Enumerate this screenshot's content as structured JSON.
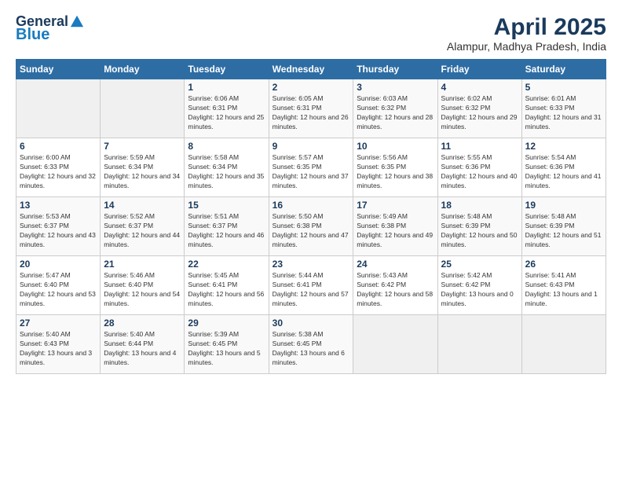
{
  "header": {
    "logo_general": "General",
    "logo_blue": "Blue",
    "month_title": "April 2025",
    "location": "Alampur, Madhya Pradesh, India"
  },
  "columns": [
    "Sunday",
    "Monday",
    "Tuesday",
    "Wednesday",
    "Thursday",
    "Friday",
    "Saturday"
  ],
  "weeks": [
    [
      {
        "day": "",
        "info": ""
      },
      {
        "day": "",
        "info": ""
      },
      {
        "day": "1",
        "info": "Sunrise: 6:06 AM\nSunset: 6:31 PM\nDaylight: 12 hours and 25 minutes."
      },
      {
        "day": "2",
        "info": "Sunrise: 6:05 AM\nSunset: 6:31 PM\nDaylight: 12 hours and 26 minutes."
      },
      {
        "day": "3",
        "info": "Sunrise: 6:03 AM\nSunset: 6:32 PM\nDaylight: 12 hours and 28 minutes."
      },
      {
        "day": "4",
        "info": "Sunrise: 6:02 AM\nSunset: 6:32 PM\nDaylight: 12 hours and 29 minutes."
      },
      {
        "day": "5",
        "info": "Sunrise: 6:01 AM\nSunset: 6:33 PM\nDaylight: 12 hours and 31 minutes."
      }
    ],
    [
      {
        "day": "6",
        "info": "Sunrise: 6:00 AM\nSunset: 6:33 PM\nDaylight: 12 hours and 32 minutes."
      },
      {
        "day": "7",
        "info": "Sunrise: 5:59 AM\nSunset: 6:34 PM\nDaylight: 12 hours and 34 minutes."
      },
      {
        "day": "8",
        "info": "Sunrise: 5:58 AM\nSunset: 6:34 PM\nDaylight: 12 hours and 35 minutes."
      },
      {
        "day": "9",
        "info": "Sunrise: 5:57 AM\nSunset: 6:35 PM\nDaylight: 12 hours and 37 minutes."
      },
      {
        "day": "10",
        "info": "Sunrise: 5:56 AM\nSunset: 6:35 PM\nDaylight: 12 hours and 38 minutes."
      },
      {
        "day": "11",
        "info": "Sunrise: 5:55 AM\nSunset: 6:36 PM\nDaylight: 12 hours and 40 minutes."
      },
      {
        "day": "12",
        "info": "Sunrise: 5:54 AM\nSunset: 6:36 PM\nDaylight: 12 hours and 41 minutes."
      }
    ],
    [
      {
        "day": "13",
        "info": "Sunrise: 5:53 AM\nSunset: 6:37 PM\nDaylight: 12 hours and 43 minutes."
      },
      {
        "day": "14",
        "info": "Sunrise: 5:52 AM\nSunset: 6:37 PM\nDaylight: 12 hours and 44 minutes."
      },
      {
        "day": "15",
        "info": "Sunrise: 5:51 AM\nSunset: 6:37 PM\nDaylight: 12 hours and 46 minutes."
      },
      {
        "day": "16",
        "info": "Sunrise: 5:50 AM\nSunset: 6:38 PM\nDaylight: 12 hours and 47 minutes."
      },
      {
        "day": "17",
        "info": "Sunrise: 5:49 AM\nSunset: 6:38 PM\nDaylight: 12 hours and 49 minutes."
      },
      {
        "day": "18",
        "info": "Sunrise: 5:48 AM\nSunset: 6:39 PM\nDaylight: 12 hours and 50 minutes."
      },
      {
        "day": "19",
        "info": "Sunrise: 5:48 AM\nSunset: 6:39 PM\nDaylight: 12 hours and 51 minutes."
      }
    ],
    [
      {
        "day": "20",
        "info": "Sunrise: 5:47 AM\nSunset: 6:40 PM\nDaylight: 12 hours and 53 minutes."
      },
      {
        "day": "21",
        "info": "Sunrise: 5:46 AM\nSunset: 6:40 PM\nDaylight: 12 hours and 54 minutes."
      },
      {
        "day": "22",
        "info": "Sunrise: 5:45 AM\nSunset: 6:41 PM\nDaylight: 12 hours and 56 minutes."
      },
      {
        "day": "23",
        "info": "Sunrise: 5:44 AM\nSunset: 6:41 PM\nDaylight: 12 hours and 57 minutes."
      },
      {
        "day": "24",
        "info": "Sunrise: 5:43 AM\nSunset: 6:42 PM\nDaylight: 12 hours and 58 minutes."
      },
      {
        "day": "25",
        "info": "Sunrise: 5:42 AM\nSunset: 6:42 PM\nDaylight: 13 hours and 0 minutes."
      },
      {
        "day": "26",
        "info": "Sunrise: 5:41 AM\nSunset: 6:43 PM\nDaylight: 13 hours and 1 minute."
      }
    ],
    [
      {
        "day": "27",
        "info": "Sunrise: 5:40 AM\nSunset: 6:43 PM\nDaylight: 13 hours and 3 minutes."
      },
      {
        "day": "28",
        "info": "Sunrise: 5:40 AM\nSunset: 6:44 PM\nDaylight: 13 hours and 4 minutes."
      },
      {
        "day": "29",
        "info": "Sunrise: 5:39 AM\nSunset: 6:45 PM\nDaylight: 13 hours and 5 minutes."
      },
      {
        "day": "30",
        "info": "Sunrise: 5:38 AM\nSunset: 6:45 PM\nDaylight: 13 hours and 6 minutes."
      },
      {
        "day": "",
        "info": ""
      },
      {
        "day": "",
        "info": ""
      },
      {
        "day": "",
        "info": ""
      }
    ]
  ]
}
